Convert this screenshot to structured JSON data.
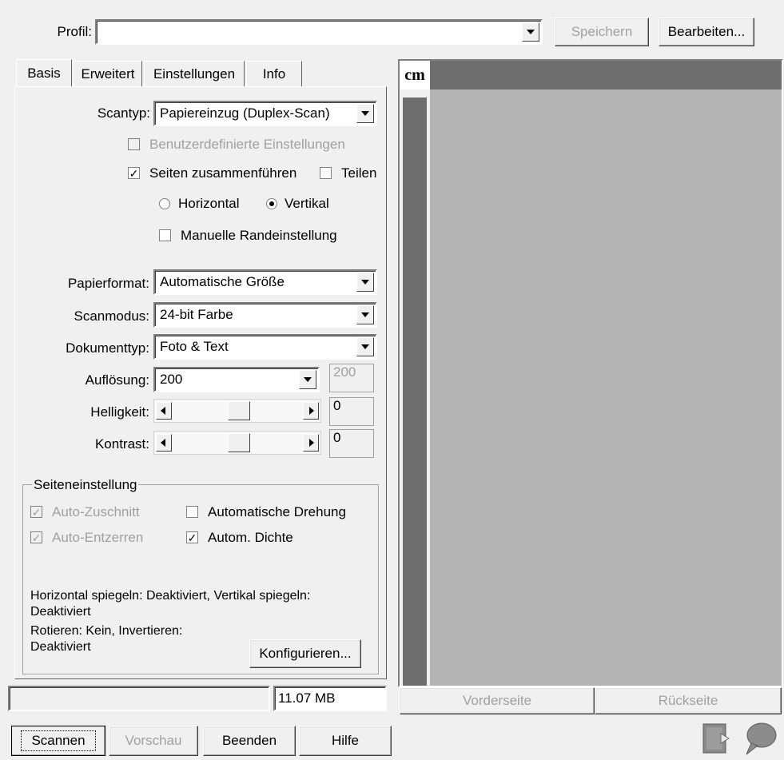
{
  "profile": {
    "label": "Profil:",
    "value": "",
    "save_label": "Speichern",
    "edit_label": "Bearbeiten..."
  },
  "tabs": [
    {
      "label": "Basis"
    },
    {
      "label": "Erweitert"
    },
    {
      "label": "Einstellungen"
    },
    {
      "label": "Info"
    }
  ],
  "basic": {
    "scantype_label": "Scantyp:",
    "scantype_value": "Papiereinzug (Duplex-Scan)",
    "custom_settings_label": "Benutzerdefinierte Einstellungen",
    "merge_pages_label": "Seiten zusammenführen",
    "split_label": "Teilen",
    "horizontal_label": "Horizontal",
    "vertical_label": "Vertikal",
    "manual_margin_label": "Manuelle Randeinstellung",
    "paper_format_label": "Papierformat:",
    "paper_format_value": "Automatische Größe",
    "scan_mode_label": "Scanmodus:",
    "scan_mode_value": "24-bit Farbe",
    "doc_type_label": "Dokumenttyp:",
    "doc_type_value": "Foto & Text",
    "resolution_label": "Auflösung:",
    "resolution_value": "200",
    "resolution_custom": "200",
    "brightness_label": "Helligkeit:",
    "brightness_value": "0",
    "contrast_label": "Kontrast:",
    "contrast_value": "0"
  },
  "page_settings": {
    "group_label": "Seiteneinstellung",
    "auto_crop_label": "Auto-Zuschnitt",
    "auto_deskew_label": "Auto-Entzerren",
    "auto_rotate_label": "Automatische Drehung",
    "auto_density_label": "Autom. Dichte",
    "info_line1": "Horizontal spiegeln: Deaktiviert, Vertikal spiegeln:",
    "info_line2": "Deaktiviert",
    "info_line3": "Rotieren: Kein, Invertieren:",
    "info_line4": "Deaktiviert",
    "configure_label": "Konfigurieren..."
  },
  "status": {
    "size": "11.07 MB"
  },
  "preview": {
    "ruler_unit": "cm",
    "front_label": "Vorderseite",
    "back_label": "Rückseite"
  },
  "bottom": {
    "scan_label": "Scannen",
    "preview_label": "Vorschau",
    "exit_label": "Beenden",
    "help_label": "Hilfe"
  },
  "colors": {
    "preview_bg": "#b4b4b4",
    "ruler_dark": "#6e6e6e"
  },
  "icons": {
    "bottom_left": "document-arrow-icon",
    "bottom_right": "speech-bubble-icon"
  }
}
